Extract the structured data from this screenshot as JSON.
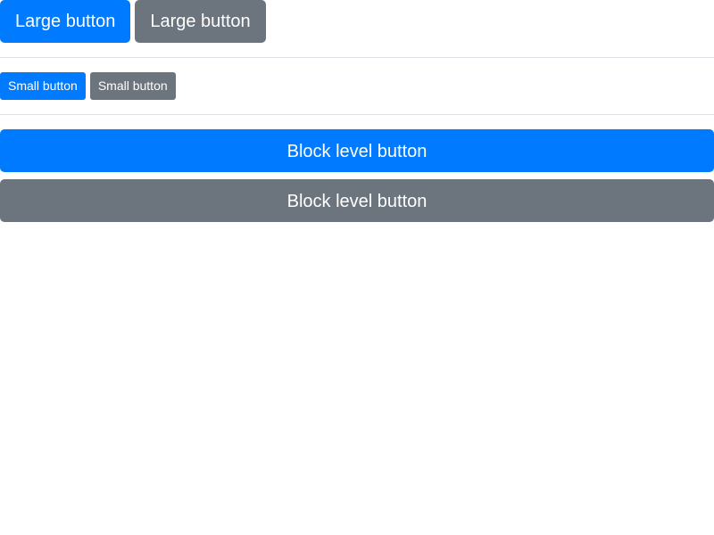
{
  "large_buttons": {
    "primary_label": "Large button",
    "secondary_label": "Large button"
  },
  "small_buttons": {
    "primary_label": "Small button",
    "secondary_label": "Small button"
  },
  "block_buttons": {
    "primary_label": "Block level button",
    "secondary_label": "Block level button"
  },
  "colors": {
    "primary": "#007bff",
    "secondary": "#6c757d",
    "divider": "#dee2e6",
    "text": "#ffffff"
  }
}
